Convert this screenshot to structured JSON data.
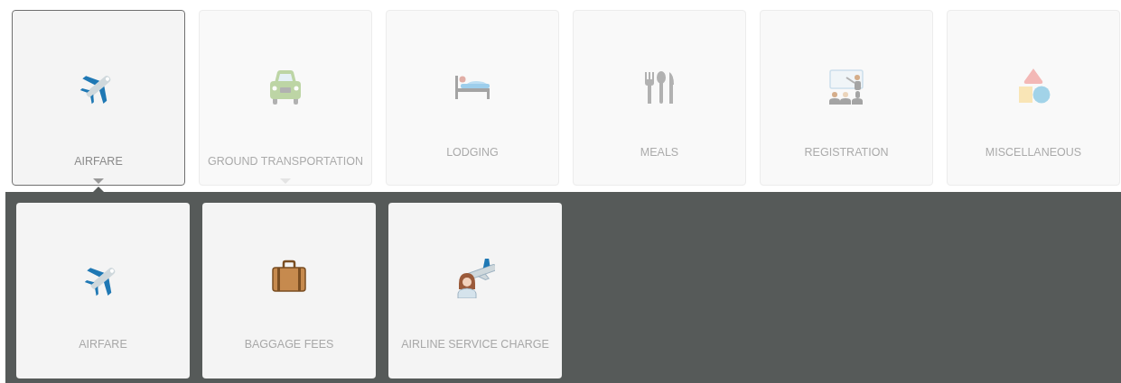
{
  "categories": [
    {
      "label": "AIRFARE",
      "kind": "plane",
      "selected": true,
      "expandable": true
    },
    {
      "label": "GROUND TRANSPORTATION",
      "kind": "car",
      "selected": false,
      "expandable": true
    },
    {
      "label": "LODGING",
      "kind": "bed",
      "selected": false,
      "expandable": false
    },
    {
      "label": "MEALS",
      "kind": "cutlery",
      "selected": false,
      "expandable": false
    },
    {
      "label": "REGISTRATION",
      "kind": "presentation",
      "selected": false,
      "expandable": false
    },
    {
      "label": "MISCELLANEOUS",
      "kind": "shapes",
      "selected": false,
      "expandable": false
    }
  ],
  "subcategories": [
    {
      "label": "AIRFARE",
      "kind": "plane"
    },
    {
      "label": "BAGGAGE FEES",
      "kind": "suitcase"
    },
    {
      "label": "AIRLINE SERVICE CHARGE",
      "kind": "attendant"
    }
  ]
}
